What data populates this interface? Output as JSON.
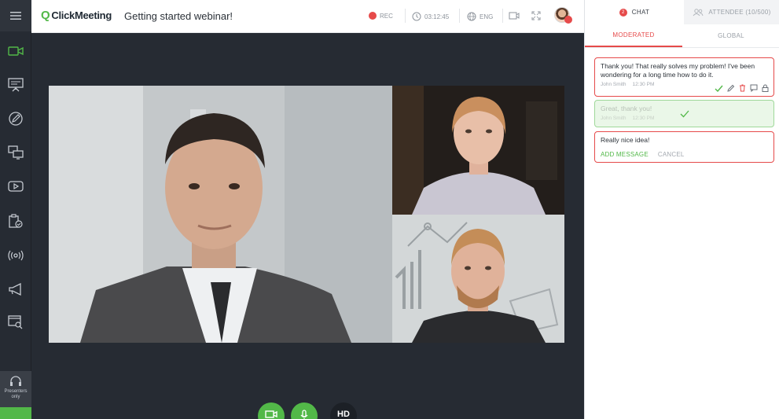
{
  "header": {
    "logo_text": "ClickMeeting",
    "logo_mark": "Q",
    "webinar_title": "Getting started webinar!",
    "rec_label": "REC",
    "timer": "03:12:45",
    "language": "ENG"
  },
  "sidebar": {
    "items": [
      {
        "icon": "menu-icon"
      },
      {
        "icon": "camera-icon"
      },
      {
        "icon": "presentation-icon"
      },
      {
        "icon": "whiteboard-pen-icon"
      },
      {
        "icon": "screen-share-icon"
      },
      {
        "icon": "video-play-icon"
      },
      {
        "icon": "clipboard-check-icon"
      },
      {
        "icon": "broadcast-icon"
      },
      {
        "icon": "megaphone-icon"
      },
      {
        "icon": "search-window-icon"
      }
    ],
    "presenters_line1": "Presenters",
    "presenters_line2": "only"
  },
  "controls": {
    "hd_label": "HD"
  },
  "panel": {
    "chat_tab": "CHAT",
    "chat_badge": "2",
    "attendee_tab": "ATTENDEE (10/500)",
    "moderated_tab": "MODERATED",
    "global_tab": "GLOBAL",
    "messages": [
      {
        "text": "Thank you! That really solves my problem! I've been wondering for a long time how to do it.",
        "author": "John Smith",
        "time": "12:30 PM"
      },
      {
        "text": "Great, thank you!",
        "author": "John Smith",
        "time": "12:30 PM"
      }
    ],
    "input_text": "Really nice idea!",
    "add_message_label": "ADD MESSAGE",
    "cancel_label": "CANCEL"
  },
  "colors": {
    "accent_green": "#52b848",
    "accent_red": "#e64a4a",
    "rail_bg": "#262b33"
  }
}
